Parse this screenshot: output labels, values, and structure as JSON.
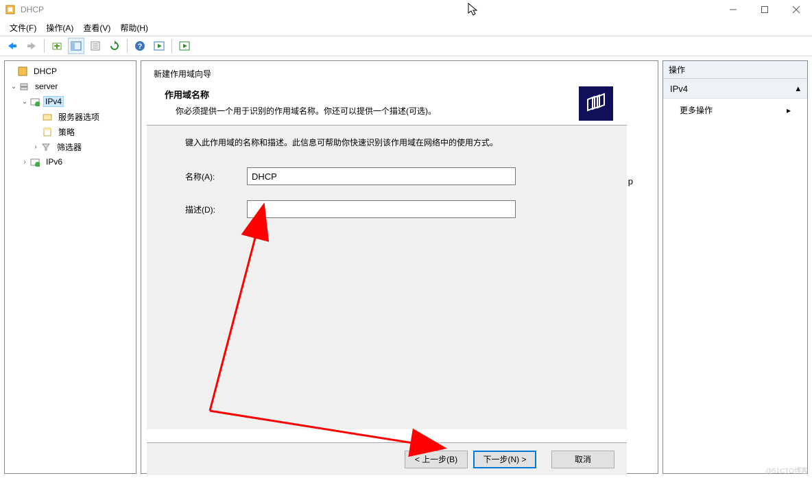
{
  "window": {
    "title": "DHCP"
  },
  "menu": {
    "file": "文件(F)",
    "action": "操作(A)",
    "view": "查看(V)",
    "help": "帮助(H)"
  },
  "tree": {
    "root": "DHCP",
    "server": "server",
    "ipv4": "IPv4",
    "server_options": "服务器选项",
    "policies": "策略",
    "filters": "筛选器",
    "ipv6": "IPv6"
  },
  "actions": {
    "title": "操作",
    "group": "IPv4",
    "more": "更多操作"
  },
  "wizard": {
    "title": "新建作用域向导",
    "heading": "作用域名称",
    "subheading": "你必须提供一个用于识别的作用域名称。你还可以提供一个描述(可选)。",
    "intro": "键入此作用域的名称和描述。此信息可帮助你快速识别该作用域在网络中的使用方式。",
    "name_label": "名称(A):",
    "name_value": "DHCP",
    "desc_label": "描述(D):",
    "desc_value": "",
    "back": "< 上一步(B)",
    "next": "下一步(N) >",
    "cancel": "取消",
    "stray": "p"
  },
  "watermark": "@51CTO博客"
}
